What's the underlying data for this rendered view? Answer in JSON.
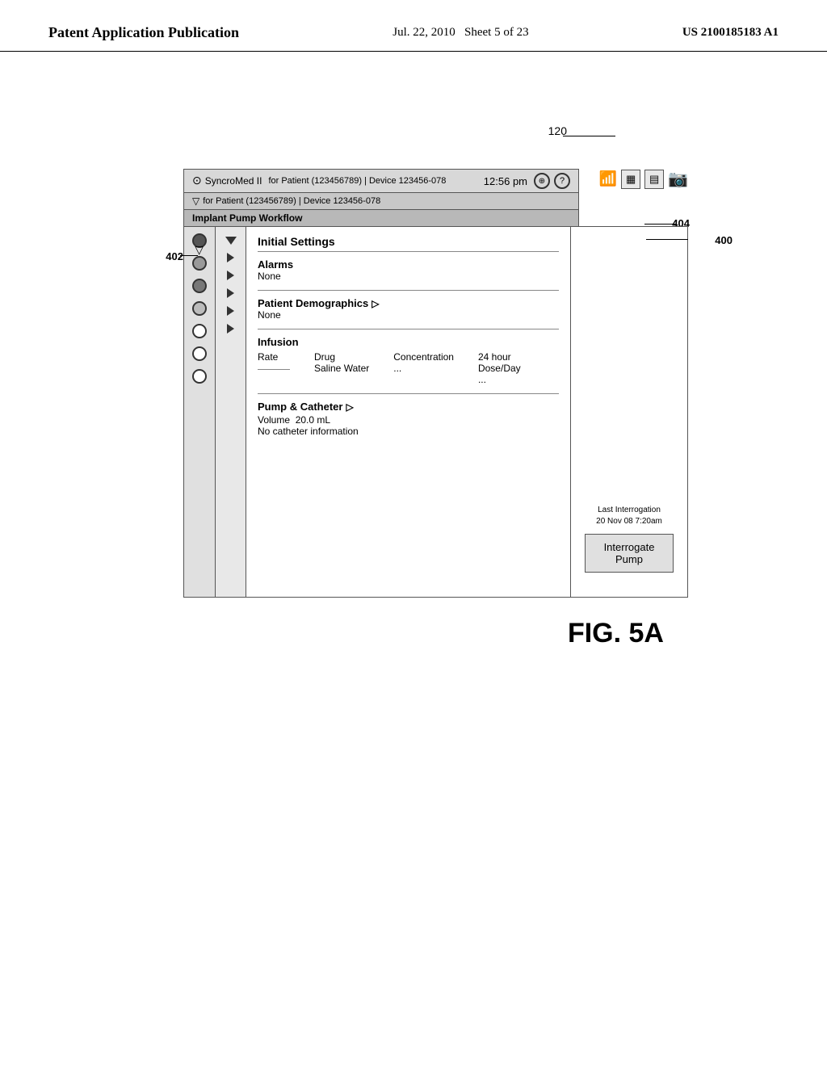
{
  "header": {
    "left_line1": "Patent Application Publication",
    "center": "Jul. 22, 2010",
    "sheet": "Sheet 5 of 23",
    "right": "US 2100185183 A1"
  },
  "figure": {
    "label": "FIG. 5A",
    "ref_120": "120",
    "ref_402": "402",
    "ref_404": "404",
    "ref_400": "400"
  },
  "toolbar": {
    "sync_label": "SyncroMed II",
    "patient_label": "for Patient (123456789) | Device 123456-078",
    "workflow_label": "Implant Pump Workflow",
    "time": "12:56 pm"
  },
  "panel": {
    "section_settings": "Initial Settings",
    "section_alarms": "Alarms",
    "alarms_value": "None",
    "section_demographics": "Patient Demographics",
    "demographics_arrow": "▷",
    "demographics_value": "None",
    "infusion_label": "Infusion",
    "rate_label": "Rate",
    "drug_label": "Drug",
    "drug_value": "Saline Water",
    "concentration_label": "Concentration",
    "concentration_value": "...",
    "hour_label": "24 hour",
    "dose_label": "Dose/Day",
    "dose_value": "...",
    "section_pump": "Pump & Catheter",
    "pump_arrow": "▷",
    "volume_label": "Volume",
    "volume_value": "20.0 mL",
    "catheter_label": "No catheter information",
    "interrogate_button": "Interrogate Pump",
    "last_interrogation_label": "Last Interrogation",
    "last_interrogation_date": "20 Nov 08 7:20am"
  },
  "icons": {
    "sync_icon": "⊙",
    "battery_icon": "▦",
    "grid_icon": "▤",
    "alarm_icon": "⊕",
    "question_icon": "?",
    "settings_icon": "⊙",
    "wifi_icon": "📶",
    "triangle_right": "▷",
    "triangle_down": "▽"
  }
}
